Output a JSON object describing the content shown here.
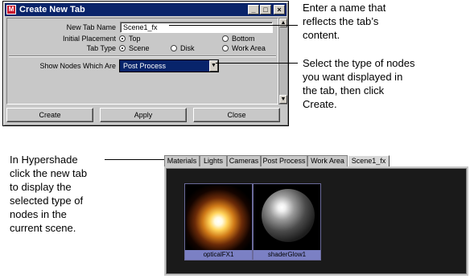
{
  "dialog": {
    "title": "Create New Tab",
    "window_buttons": {
      "minimize": "_",
      "maximize": "□",
      "close": "×"
    },
    "new_tab_name_label": "New Tab Name",
    "new_tab_name_value": "Scene1_fx",
    "initial_placement_label": "Initial Placement",
    "initial_placement_options": [
      "Top",
      "Bottom"
    ],
    "initial_placement_selected": "Top",
    "tab_type_label": "Tab Type",
    "tab_type_options": [
      "Scene",
      "Disk",
      "Work Area"
    ],
    "tab_type_selected": "Scene",
    "show_nodes_label": "Show Nodes Which Are",
    "show_nodes_value": "Post Process",
    "buttons": {
      "create": "Create",
      "apply": "Apply",
      "close": "Close"
    }
  },
  "annotations": {
    "name_note": [
      "Enter a name that",
      "reflects the tab’s",
      "content."
    ],
    "type_note": [
      "Select the type of nodes",
      "you want displayed in",
      "the tab, then click",
      "Create."
    ],
    "hypershade_note": [
      "In Hypershade",
      "click the new tab",
      "to display the",
      "selected type of",
      "nodes in the",
      "current scene."
    ]
  },
  "hypershade": {
    "tabs": [
      "Materials",
      "Lights",
      "Cameras",
      "Post Process",
      "Work Area",
      "Scene1_fx"
    ],
    "active_tab": "Scene1_fx",
    "swatches": [
      {
        "label": "opticalFX1",
        "icon": "optical-fx-glow"
      },
      {
        "label": "shaderGlow1",
        "icon": "shader-glow-sphere"
      }
    ]
  }
}
